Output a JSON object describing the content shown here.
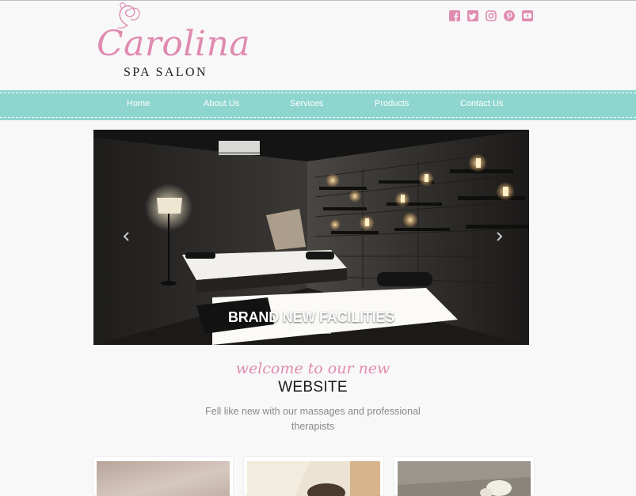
{
  "brand": {
    "script_name": "Carolina",
    "subtitle": "SPA SALON",
    "accent_color": "#e08bb0",
    "nav_color": "#8ed5cf"
  },
  "social": [
    {
      "icon": "facebook-icon"
    },
    {
      "icon": "twitter-icon"
    },
    {
      "icon": "instagram-icon"
    },
    {
      "icon": "pinterest-icon"
    },
    {
      "icon": "youtube-icon"
    }
  ],
  "nav": {
    "items": [
      {
        "label": "Home"
      },
      {
        "label": "About Us"
      },
      {
        "label": "Services"
      },
      {
        "label": "Products"
      },
      {
        "label": "Contact Us"
      }
    ]
  },
  "slider": {
    "caption": "BRAND NEW FACILITIES",
    "slide_count": 3,
    "active_slide": 1
  },
  "welcome": {
    "script": "welcome to our new",
    "title": "WEBSITE",
    "text": "Fell like new with our massages and professional therapists"
  }
}
